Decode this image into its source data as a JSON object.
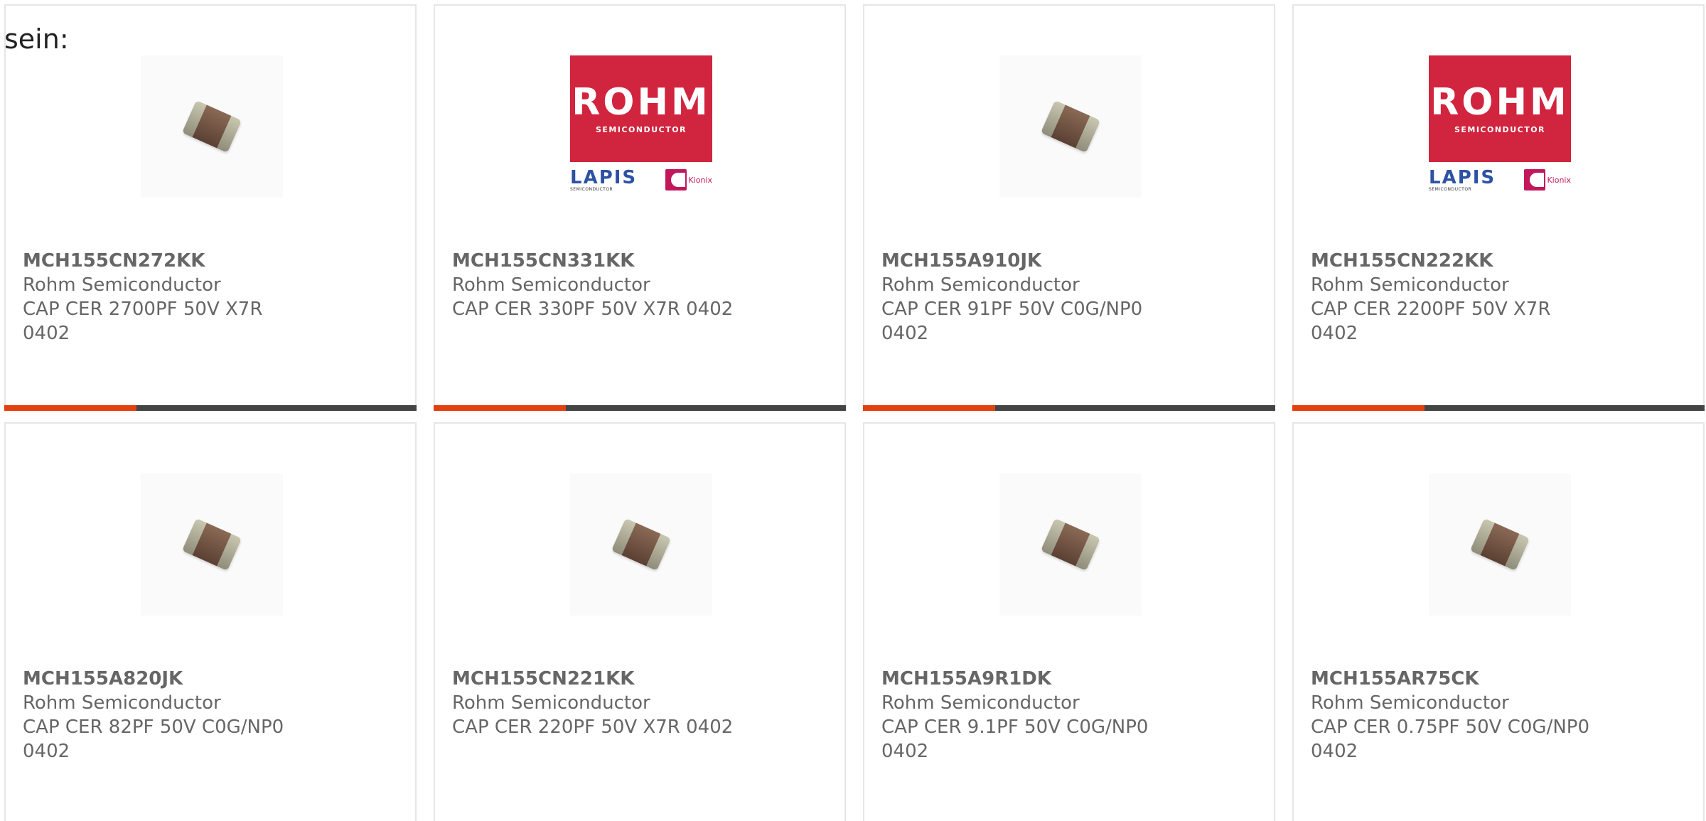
{
  "heading": "sein:",
  "colors": {
    "accent": "#e2400f",
    "bar_track": "#444444",
    "text": "#666666",
    "rohm_red": "#d1243e"
  },
  "cards": [
    {
      "part": "MCH155CN272KK",
      "manufacturer": "Rohm Semiconductor",
      "description": "CAP CER 2700PF 50V X7R 0402",
      "image": "capacitor-chip",
      "progress": 0.32
    },
    {
      "part": "MCH155CN331KK",
      "manufacturer": "Rohm Semiconductor",
      "description": "CAP CER 330PF 50V X7R 0402",
      "image": "rohm-logo",
      "progress": 0.32
    },
    {
      "part": "MCH155A910JK",
      "manufacturer": "Rohm Semiconductor",
      "description": "CAP CER 91PF 50V C0G/NP0 0402",
      "image": "capacitor-chip",
      "progress": 0.32
    },
    {
      "part": "MCH155CN222KK",
      "manufacturer": "Rohm Semiconductor",
      "description": "CAP CER 2200PF 50V X7R 0402",
      "image": "rohm-logo",
      "progress": 0.32
    },
    {
      "part": "MCH155A820JK",
      "manufacturer": "Rohm Semiconductor",
      "description": "CAP CER 82PF 50V C0G/NP0 0402",
      "image": "capacitor-chip"
    },
    {
      "part": "MCH155CN221KK",
      "manufacturer": "Rohm Semiconductor",
      "description": "CAP CER 220PF 50V X7R 0402",
      "image": "capacitor-chip"
    },
    {
      "part": "MCH155A9R1DK",
      "manufacturer": "Rohm Semiconductor",
      "description": "CAP CER 9.1PF 50V C0G/NP0 0402",
      "image": "capacitor-chip"
    },
    {
      "part": "MCH155AR75CK",
      "manufacturer": "Rohm Semiconductor",
      "description": "CAP CER 0.75PF 50V C0G/NP0 0402",
      "image": "capacitor-chip"
    }
  ],
  "logo_text": {
    "rohm": "ROHM",
    "rohm_sub": "SEMICONDUCTOR",
    "lapis": "LAPIS",
    "lapis_sub": "SEMICONDUCTOR",
    "kionix": "Kionix"
  }
}
